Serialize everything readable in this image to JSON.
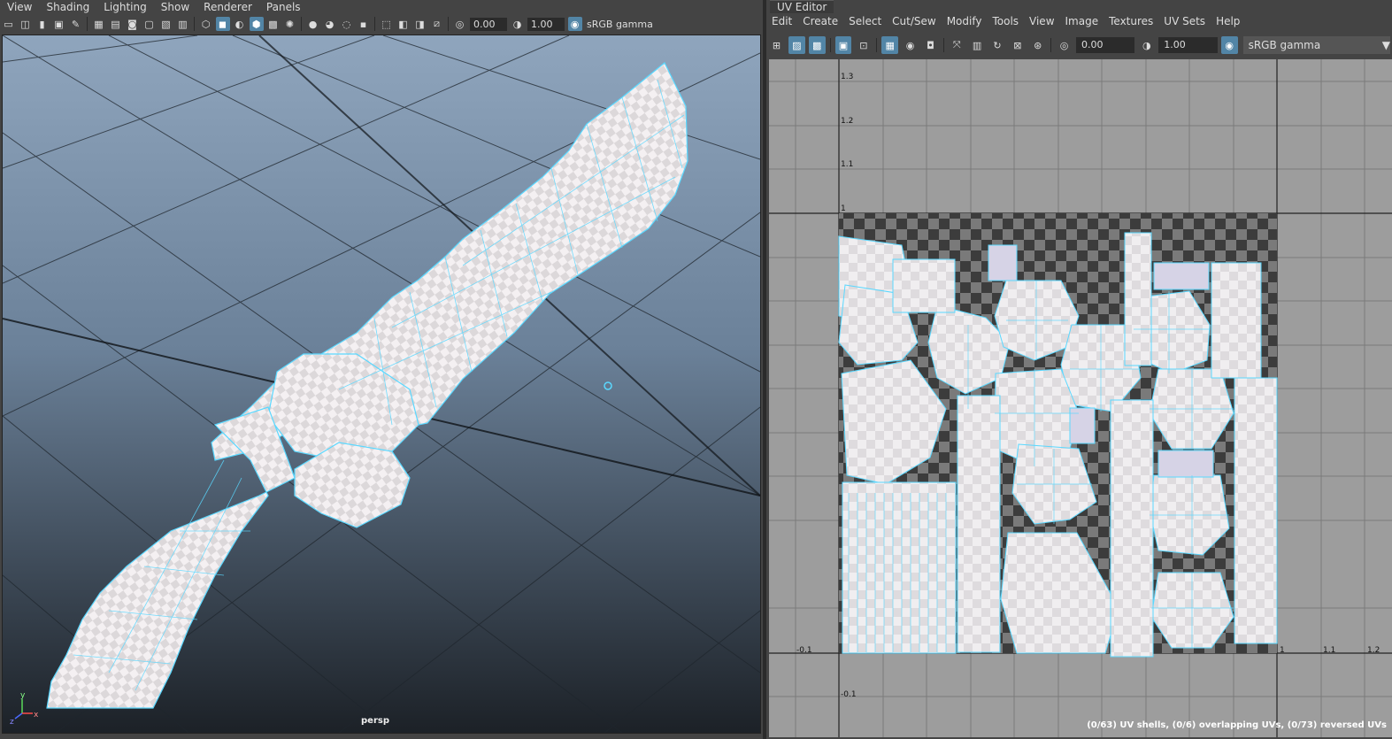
{
  "viewport": {
    "menu": [
      "View",
      "Shading",
      "Lighting",
      "Show",
      "Renderer",
      "Panels"
    ],
    "exposure": "0.00",
    "gamma": "1.00",
    "color_space": "sRGB gamma",
    "camera_label": "persp",
    "axis_labels": {
      "y": "y",
      "x": "x",
      "z": "z"
    }
  },
  "uv_editor": {
    "title": "UV Editor",
    "menu": [
      "Edit",
      "Create",
      "Select",
      "Cut/Sew",
      "Modify",
      "Tools",
      "View",
      "Image",
      "Textures",
      "UV Sets",
      "Help"
    ],
    "exposure": "0.00",
    "gamma": "1.00",
    "color_space": "sRGB gamma",
    "grid_labels_v": [
      "1.3",
      "1.2",
      "1.1",
      "1",
      "-0.1"
    ],
    "grid_labels_u": [
      "-0.1",
      "1",
      "1.1",
      "1.2"
    ],
    "status": "(0/63) UV shells, (0/6) overlapping UVs, (0/73) reversed UVs"
  },
  "colors": {
    "accent": "#5285a6",
    "wire": "#5ad8ff",
    "grid_bg": "#9d9d9d"
  }
}
